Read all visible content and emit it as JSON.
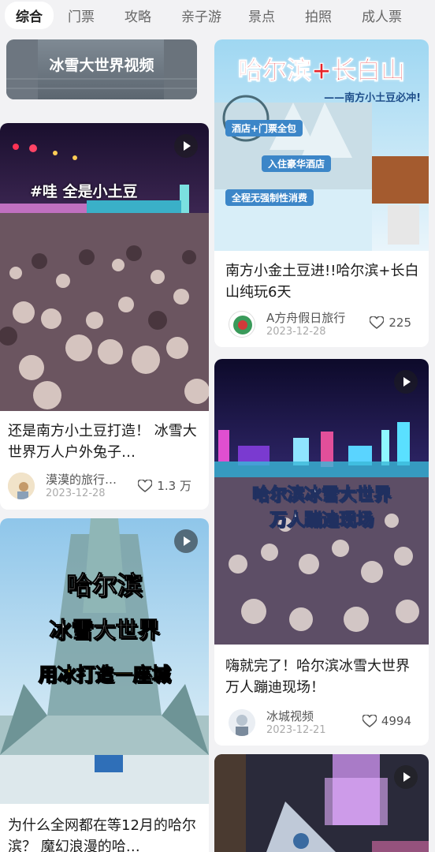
{
  "tabs": [
    {
      "label": "综合",
      "active": true
    },
    {
      "label": "门票",
      "active": false
    },
    {
      "label": "攻略",
      "active": false
    },
    {
      "label": "亲子游",
      "active": false
    },
    {
      "label": "景点",
      "active": false
    },
    {
      "label": "拍照",
      "active": false
    },
    {
      "label": "成人票",
      "active": false
    }
  ],
  "cards": {
    "c0": {
      "overlay": "冰雪大世界视频"
    },
    "c1": {
      "overlay": "#哇    全是小土豆",
      "title": "还是南方小土豆打造！ 冰雪大世界万人户外兔子…",
      "author": "漠漠的旅行…",
      "date": "2023-12-28",
      "likes": "1.3 万"
    },
    "c2": {
      "overlay_lines": [
        "哈尔滨",
        "冰雪大世界",
        "用冰打造一座城"
      ],
      "title": "为什么全网都在等12月的哈尔滨？ 魔幻浪漫的哈…"
    },
    "c3": {
      "overlay_title": "哈尔滨+长白山",
      "overlay_sub": "——南方小土豆必冲!",
      "overlay_tags": [
        "酒店+门票全包",
        "入住豪华酒店",
        "全程无强制性消费"
      ],
      "title": "南方小金土豆进!!哈尔滨+长白山纯玩6天",
      "author": "A方舟假日旅行",
      "date": "2023-12-28",
      "likes": "225"
    },
    "c4": {
      "overlay_lines": [
        "哈尔滨冰雪大世界",
        "万人蹦迪现场"
      ],
      "title": "嗨就完了！哈尔滨冰雪大世界万人蹦迪现场！",
      "author": "冰城视频",
      "date": "2023-12-21",
      "likes": "4994"
    }
  }
}
